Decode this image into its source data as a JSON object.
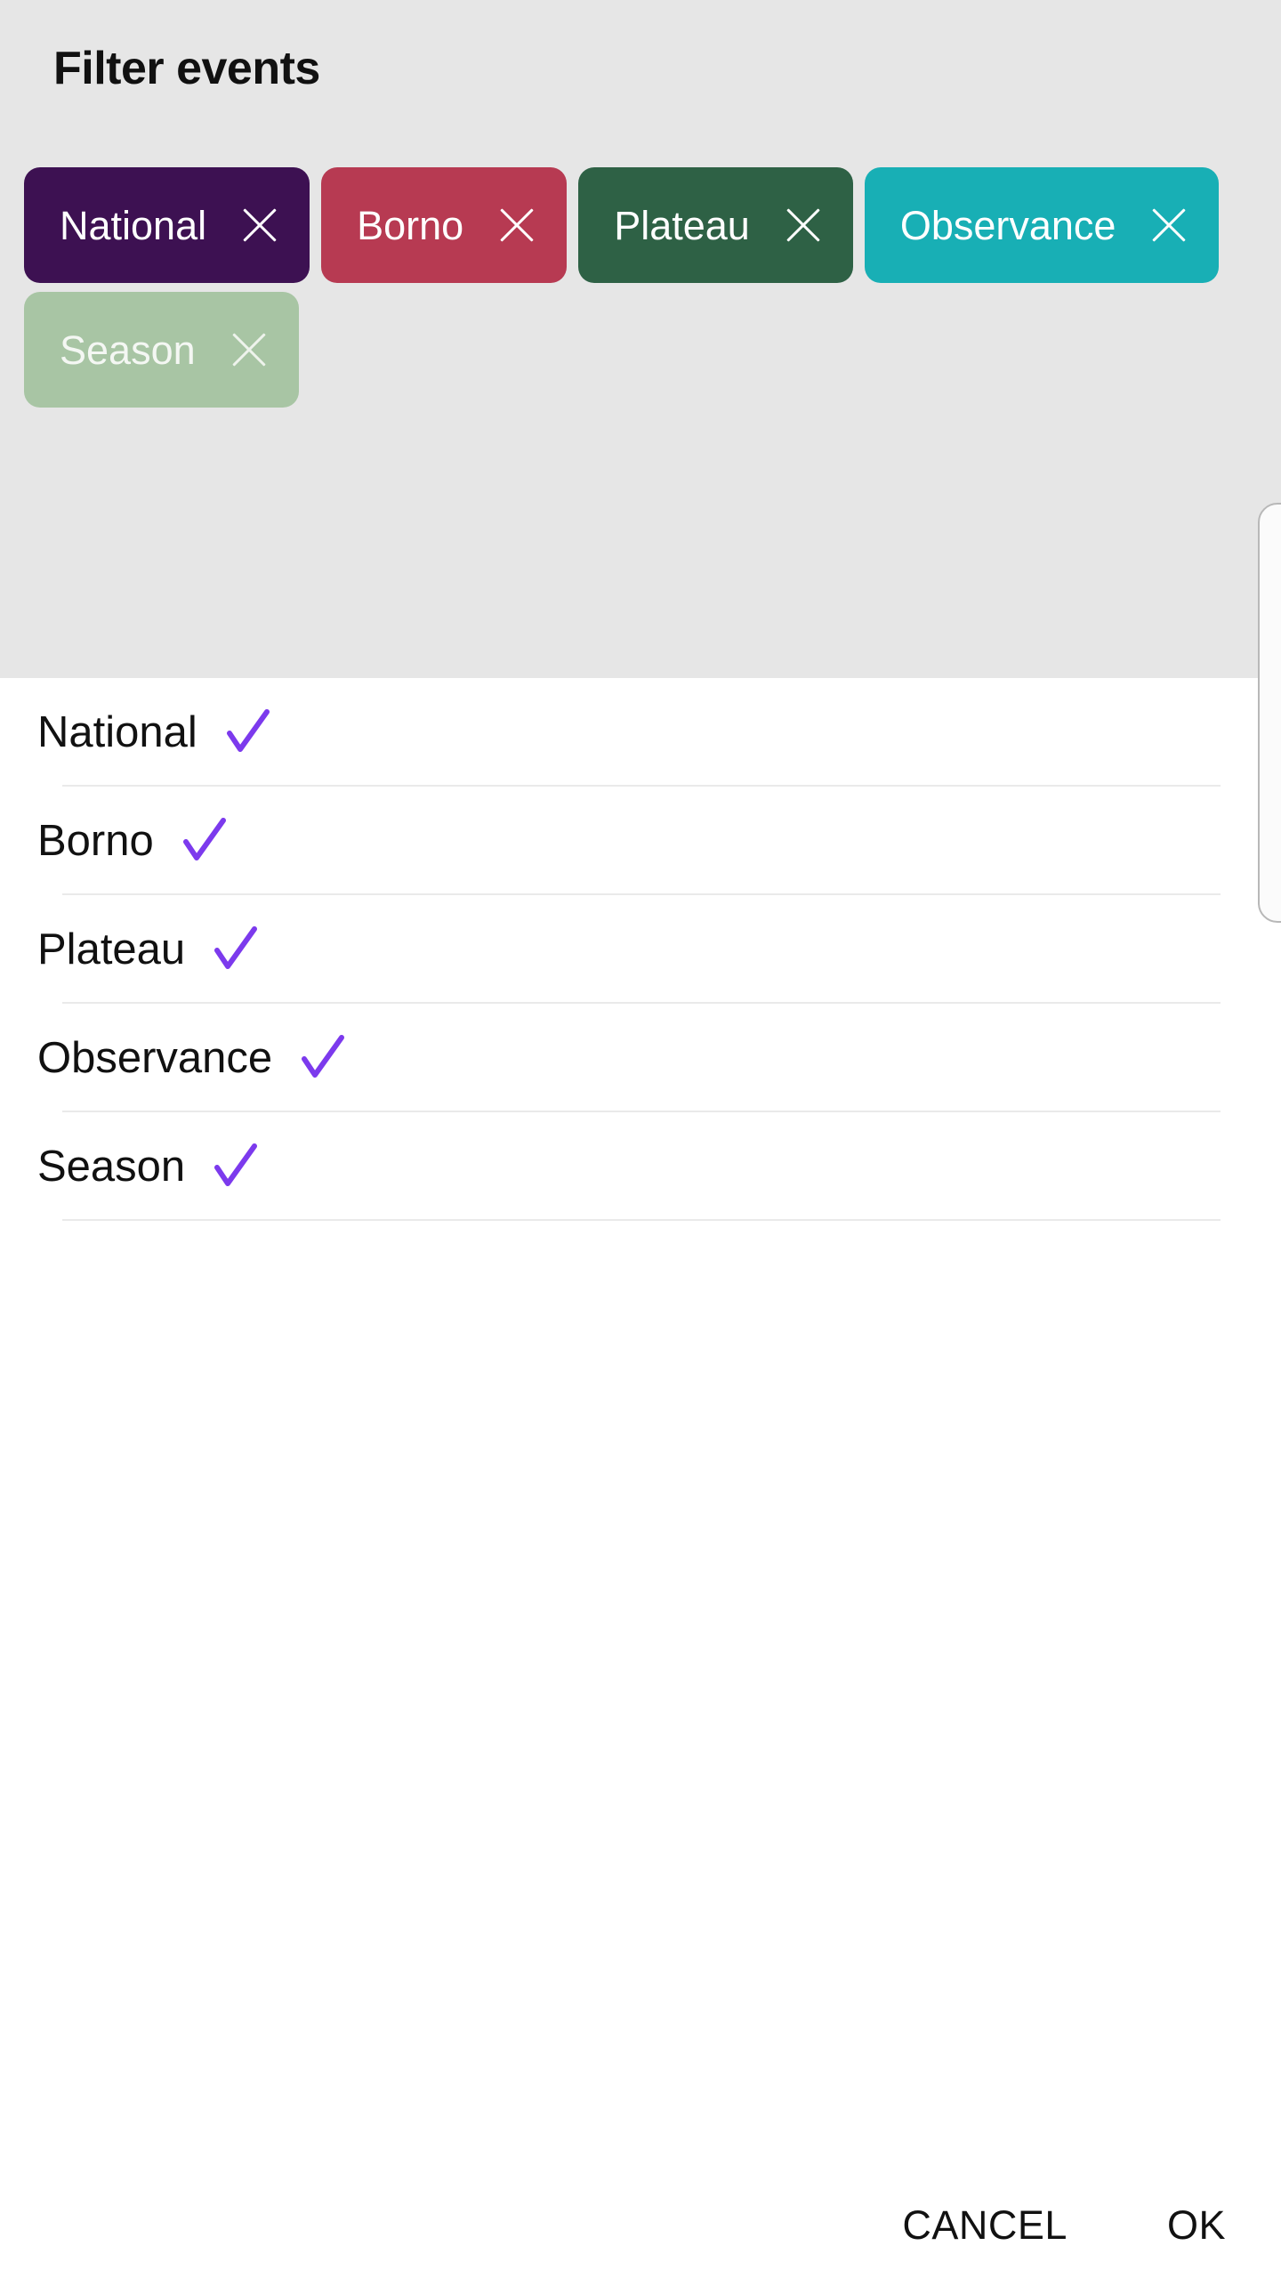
{
  "dialog": {
    "title": "Filter events"
  },
  "colors": {
    "panel_background": "#e6e6e6",
    "body_background": "#ffffff",
    "divider": "#eaeaea",
    "checkmark": "#7C3AED",
    "text_primary": "#111111",
    "chip_text": "#ffffff"
  },
  "chips": [
    {
      "label": "National",
      "color": "#3D1152",
      "text_color": "#ffffff",
      "remove_icon": "close-icon",
      "muted": false
    },
    {
      "label": "Borno",
      "color": "#B73A52",
      "text_color": "#ffffff",
      "remove_icon": "close-icon",
      "muted": false
    },
    {
      "label": "Plateau",
      "color": "#2E6145",
      "text_color": "#ffffff",
      "remove_icon": "close-icon",
      "muted": false
    },
    {
      "label": "Observance",
      "color": "#18AFB5",
      "text_color": "#ffffff",
      "remove_icon": "close-icon",
      "muted": false
    },
    {
      "label": "Season",
      "color": "#A8C5A4",
      "text_color": "#f4f7f3",
      "remove_icon": "close-icon",
      "muted": true
    }
  ],
  "list": {
    "items": [
      {
        "label": "National",
        "checked": true,
        "check_icon": "checkmark-icon"
      },
      {
        "label": "Borno",
        "checked": true,
        "check_icon": "checkmark-icon"
      },
      {
        "label": "Plateau",
        "checked": true,
        "check_icon": "checkmark-icon"
      },
      {
        "label": "Observance",
        "checked": true,
        "check_icon": "checkmark-icon"
      },
      {
        "label": "Season",
        "checked": true,
        "check_icon": "checkmark-icon"
      }
    ]
  },
  "footer": {
    "cancel_label": "CANCEL",
    "ok_label": "OK"
  }
}
